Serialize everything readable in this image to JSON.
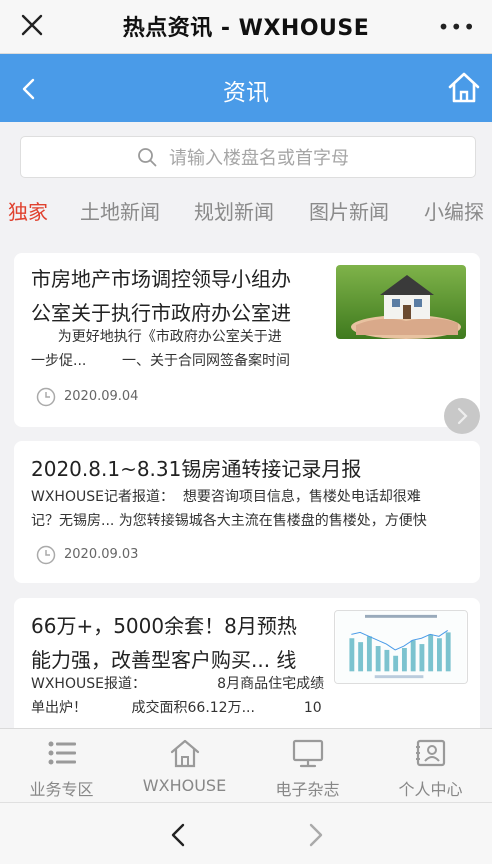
{
  "browser": {
    "title": "热点资讯 - WXHOUSE",
    "more_glyph": "•••"
  },
  "header": {
    "title": "资讯"
  },
  "search": {
    "placeholder": "请输入楼盘名或首字母"
  },
  "tabs": [
    {
      "label": "独家",
      "active": true
    },
    {
      "label": "土地新闻",
      "active": false
    },
    {
      "label": "规划新闻",
      "active": false
    },
    {
      "label": "图片新闻",
      "active": false
    },
    {
      "label": "小编探",
      "active": false
    }
  ],
  "articles": [
    {
      "title_line1": "市房地产市场调控领导小组办",
      "title_line2": "公室关于执行市政府办公室进",
      "summary_line1": "      为更好地执行《市政府办公室关于进",
      "summary_line2": "一步促...        一、关于合同网签备案时间",
      "date": "2020.09.04",
      "thumb_icon": "house-in-hand-image"
    },
    {
      "title_line1": "2020.8.1~8.31锡房通转接记录月报",
      "summary_line1": "WXHOUSE记者报道：  想要咨询项目信息，售楼处电话却很难",
      "summary_line2": "记？无锡房... 为您转接锡城各大主流在售楼盘的售楼处，方便快",
      "date": "2020.09.03"
    },
    {
      "title_line1": "66万+，5000余套！8月预热",
      "title_line2": "能力强，改善型客户购买... 线",
      "summary_line1": "WXHOUSE报道：                8月商品住宅成绩",
      "summary_line2": "单出炉！          成交面积66.12万...           10",
      "thumb_icon": "sales-chart-image"
    }
  ],
  "bottom_nav": [
    {
      "label": "业务专区",
      "icon": "list-icon"
    },
    {
      "label": "WXHOUSE",
      "icon": "house-icon"
    },
    {
      "label": "电子杂志",
      "icon": "monitor-icon"
    },
    {
      "label": "个人中心",
      "icon": "id-card-icon"
    }
  ],
  "colors": {
    "header_blue": "#4a9be8",
    "tab_active": "#e0412e"
  }
}
